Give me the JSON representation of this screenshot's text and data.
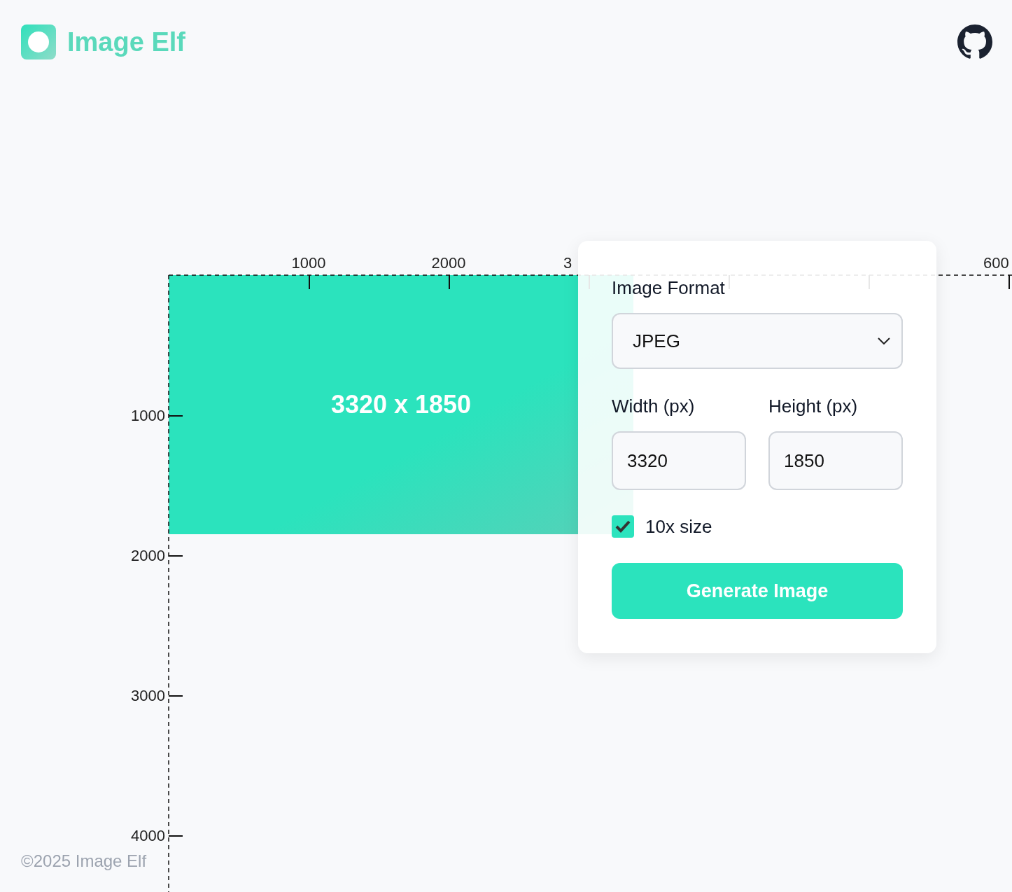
{
  "header": {
    "logo_text": "Image Elf"
  },
  "canvas": {
    "x_ticks": [
      {
        "kind": "full",
        "label": "1000"
      },
      {
        "kind": "full",
        "label": "2000"
      },
      {
        "kind": "cut",
        "label": "3"
      },
      {
        "kind": "covered"
      },
      {
        "kind": "covered"
      },
      {
        "kind": "cut",
        "label": "600"
      }
    ],
    "y_ticks": [
      "1000",
      "2000",
      "3000",
      "4000"
    ],
    "image_label": "3320 x 1850"
  },
  "form": {
    "format_label": "Image Format",
    "format_value": "JPEG",
    "width_label": "Width (px)",
    "width_value": "3320",
    "height_label": "Height (px)",
    "height_value": "1850",
    "tenx": {
      "label": "10x size",
      "checked": true
    },
    "button": "Generate Image"
  },
  "footer": "©2025 Image Elf"
}
